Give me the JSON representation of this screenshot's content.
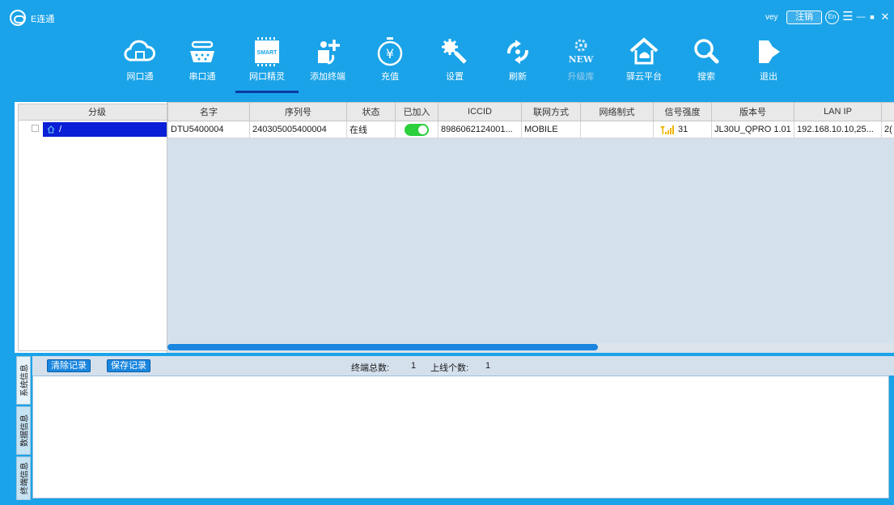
{
  "app": {
    "title": "E连通"
  },
  "titlebar": {
    "user": "vey",
    "logout_label": "注销",
    "lang_label": "En",
    "menu_glyph": "☰",
    "minimize_glyph": "—",
    "maximize_glyph": "■",
    "close_glyph": "✕"
  },
  "toolbar": {
    "items": [
      {
        "label": "网口通",
        "icon": "cloud-icon"
      },
      {
        "label": "串口通",
        "icon": "serial-port-icon"
      },
      {
        "label": "网口精灵",
        "icon": "smart-chip-icon",
        "badge": "SMART"
      },
      {
        "label": "添加终端",
        "icon": "add-device-icon"
      },
      {
        "label": "充值",
        "icon": "recharge-icon"
      },
      {
        "label": "设置",
        "icon": "settings-icon"
      },
      {
        "label": "刷新",
        "icon": "refresh-icon"
      },
      {
        "label": "升级库",
        "icon": "new-upgrade-icon",
        "badge": "NEW"
      },
      {
        "label": "驿云平台",
        "icon": "cloud-home-icon"
      },
      {
        "label": "搜索",
        "icon": "search-icon"
      },
      {
        "label": "退出",
        "icon": "exit-icon"
      }
    ],
    "active": "网口精灵"
  },
  "tree": {
    "header": "分级",
    "root_label": "/"
  },
  "table": {
    "columns": [
      "名字",
      "序列号",
      "状态",
      "已加入",
      "ICCID",
      "联网方式",
      "网络制式",
      "信号强度",
      "版本号",
      "LAN IP",
      ""
    ],
    "rows": [
      {
        "name": "DTU5400004",
        "serial": "240305005400004",
        "status": "在线",
        "joined": true,
        "iccid": "8986062124001...",
        "network": "MOBILE",
        "network_type": "",
        "signal": "31",
        "version": "JL30U_QPRO 1.01",
        "lan_ip": "192.168.10.10,25...",
        "extra": "2("
      }
    ]
  },
  "log": {
    "clear_label": "清除记录",
    "save_label": "保存记录",
    "total_label": "终端总数:",
    "total_value": "1",
    "online_label": "上线个数:",
    "online_value": "1"
  },
  "side_tabs": [
    "系统信息",
    "数据信息",
    "终端信息"
  ],
  "colors": {
    "chrome": "#1aa3e8",
    "selection": "#0a1fd6",
    "toggle_on": "#2ccf3c",
    "scroll_thumb": "#1a86df",
    "signal": "#f0b400"
  }
}
